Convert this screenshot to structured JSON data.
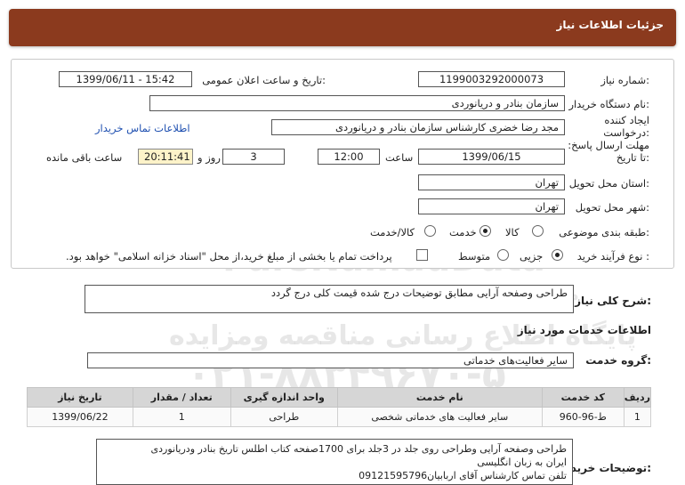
{
  "header": {
    "title": "جزئیات اطلاعات نیاز"
  },
  "need_number": {
    "label": "شماره نیاز:",
    "value": "1199003292000073"
  },
  "announce_datetime": {
    "label": "تاریخ و ساعت اعلان عمومی:",
    "value": "1399/06/11 - 15:42"
  },
  "buyer_org": {
    "label": "نام دستگاه خریدار:",
    "value": "سازمان بنادر و دریانوردی"
  },
  "requester": {
    "label": "ایجاد کننده درخواست:",
    "value": "مجد رضا خضری کارشناس سازمان بنادر و دریانوردی",
    "contact_link": "اطلاعات تماس خریدار"
  },
  "deadline": {
    "label": "مهلت ارسال پاسخ: تا تاریخ:",
    "date": "1399/06/15",
    "time_label": "ساعت",
    "time": "12:00",
    "days": "3",
    "days_label": "روز و",
    "remaining": "20:11:41",
    "remaining_label": "ساعت باقی مانده"
  },
  "province": {
    "label": "استان محل تحویل:",
    "value": "تهران"
  },
  "city": {
    "label": "شهر محل تحویل:",
    "value": "تهران"
  },
  "category": {
    "label": "طبقه بندی موضوعی:",
    "options": [
      "کالا",
      "خدمت",
      "کالا/خدمت"
    ],
    "selected": "خدمت"
  },
  "purchase_process": {
    "label": "نوع فرآیند خرید :",
    "options": [
      "جزیی",
      "متوسط"
    ],
    "selected": "جزیی",
    "payment_note": "پرداخت تمام یا بخشی از مبلغ خرید،از محل \"اسناد خزانه اسلامی\" خواهد بود."
  },
  "description": {
    "label": "شرح کلی نیاز:",
    "value": "طراحی وصفحه آرایی مطابق توضیحات درج شده قیمت کلی درج گردد"
  },
  "services_info": {
    "title": "اطلاعات خدمات مورد نیاز"
  },
  "service_group": {
    "label": "گروه خدمت:",
    "value": "سایر فعالیت‌های خدماتی"
  },
  "table": {
    "headers": [
      "ردیف",
      "کد خدمت",
      "نام خدمت",
      "واحد اندازه گیری",
      "تعداد / مقدار",
      "تاریخ نیاز"
    ],
    "rows": [
      [
        "1",
        "ط-96-960",
        "سایر فعالیت های خدماتی شخصی",
        "طراحی",
        "1",
        "1399/06/22"
      ]
    ]
  },
  "buyer_notes": {
    "label": "توضیحات خریدار:",
    "lines": [
      "طراحی وصفحه آرایی وطراحی روی جلد در 3جلد برای 1700صفحه کتاب اطلس تاریخ بنادر ودریانوردی",
      "ایران به زبان انگلیسی",
      "تلفن تماس کارشناس آقای اربابیان09121595796"
    ]
  },
  "watermark": {
    "line1": "ParsNamadData",
    "line2": "مرکز فراوری اطلاعات پارس نماد داده ها",
    "line3": "پایگاه اطلاع رسانی مناقصه ومزایده",
    "line4": "۰۲۱-۸۸۳۴۹۶۷۰-۵"
  }
}
